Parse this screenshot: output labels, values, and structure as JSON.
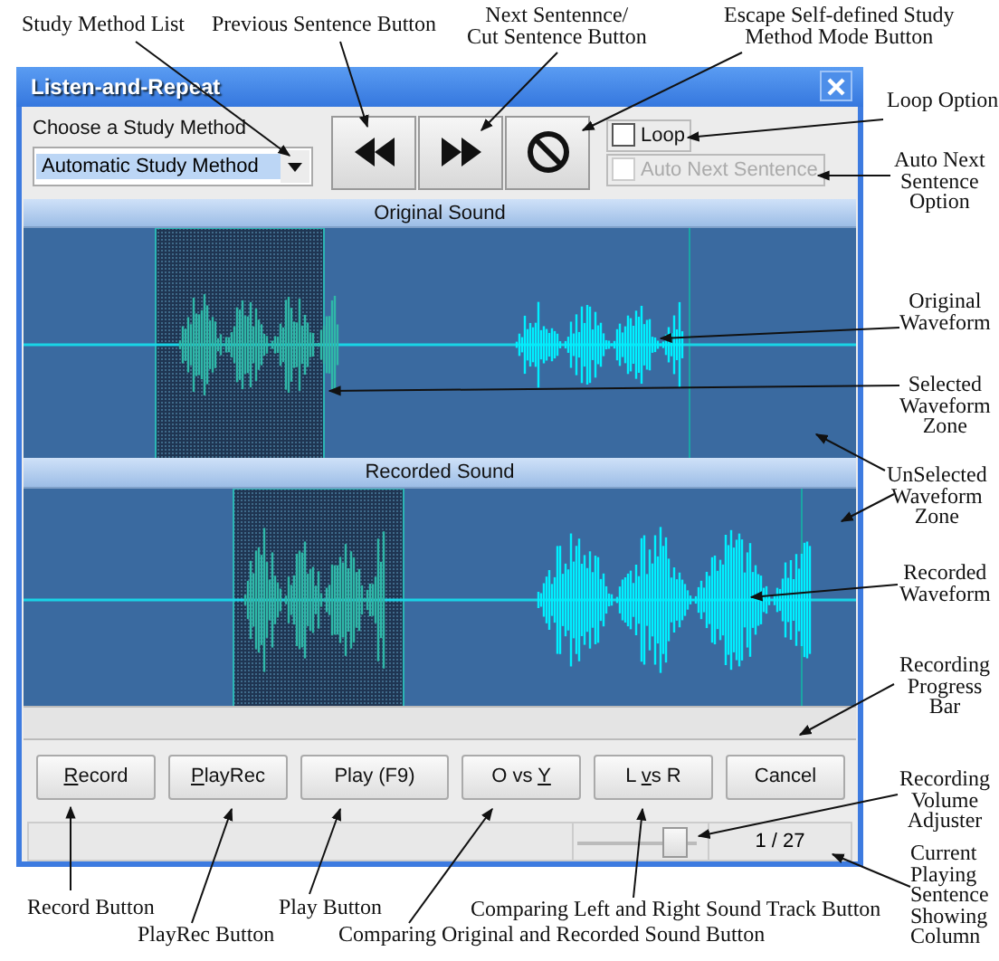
{
  "window": {
    "title": "Listen-and-Repeat"
  },
  "study_method": {
    "label": "Choose a Study Method",
    "value": "Automatic Study Method"
  },
  "options": [
    {
      "label": "Loop",
      "checked": false,
      "disabled": false
    },
    {
      "label": "Auto Next Sentence",
      "checked": false,
      "disabled": true
    }
  ],
  "tracks": [
    {
      "title": "Original Sound"
    },
    {
      "title": "Recorded Sound"
    }
  ],
  "recording_progress": {
    "level": 0
  },
  "buttons": [
    {
      "key": "R",
      "post": "ecord"
    },
    {
      "key": "P",
      "post": "layRec"
    },
    {
      "pre": "Play (F9)"
    },
    {
      "pre": "O vs ",
      "key": "Y"
    },
    {
      "pre": "L ",
      "key": "v",
      "post": "s R"
    },
    {
      "pre": "Cancel"
    }
  ],
  "volume": {
    "level": 0.9
  },
  "sentence_counter": "1 / 27",
  "annotations": [
    {
      "text": "Study Method List"
    },
    {
      "text": "Previous Sentence Button"
    },
    {
      "text": "Next Sentennce/\nCut Sentence Button"
    },
    {
      "text": "Escape Self-defined Study\nMethod Mode Button"
    },
    {
      "text": "Loop Option"
    },
    {
      "text": "Auto Next\nSentence\nOption"
    },
    {
      "text": "Original\nWaveform"
    },
    {
      "text": "Selected\nWaveform\nZone"
    },
    {
      "text": "UnSelected\nWaveform\nZone"
    },
    {
      "text": "Recorded\nWaveform"
    },
    {
      "text": "Recording\nProgress\nBar"
    },
    {
      "text": "Recording\nVolume\nAdjuster"
    },
    {
      "text": "Record Button"
    },
    {
      "text": "PlayRec Button"
    },
    {
      "text": "Play Button"
    },
    {
      "text": "Comparing Original and Recorded Sound Button"
    },
    {
      "text": "Comparing Left and Right Sound Track Button"
    },
    {
      "text": "Current\nPlaying\nSentence\nShowing\nColumn"
    }
  ]
}
